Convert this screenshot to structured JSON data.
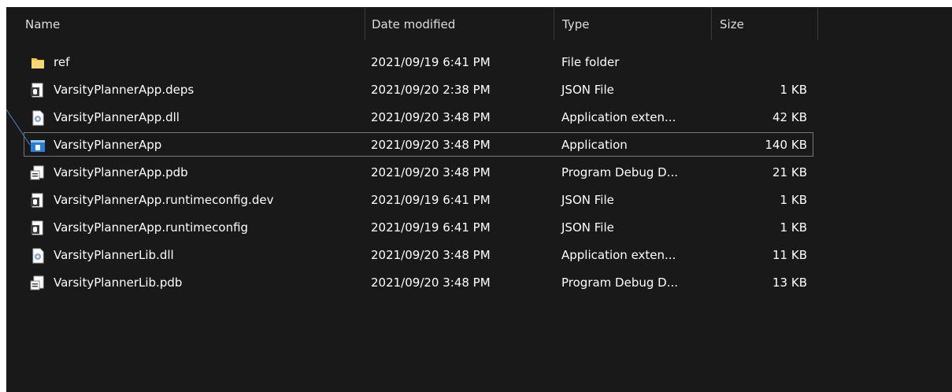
{
  "columns": {
    "name": "Name",
    "date_modified": "Date modified",
    "type": "Type",
    "size": "Size"
  },
  "files": [
    {
      "name": "ref",
      "date": "2021/09/19 6:41 PM",
      "type": "File folder",
      "size": "",
      "icon": "folder-icon"
    },
    {
      "name": "VarsityPlannerApp.deps",
      "date": "2021/09/20 2:38 PM",
      "type": "JSON File",
      "size": "1 KB",
      "icon": "json-file-icon"
    },
    {
      "name": "VarsityPlannerApp.dll",
      "date": "2021/09/20 3:48 PM",
      "type": "Application exten...",
      "size": "42 KB",
      "icon": "dll-file-icon"
    },
    {
      "name": "VarsityPlannerApp",
      "date": "2021/09/20 3:48 PM",
      "type": "Application",
      "size": "140 KB",
      "icon": "application-icon",
      "selected": true
    },
    {
      "name": "VarsityPlannerApp.pdb",
      "date": "2021/09/20 3:48 PM",
      "type": "Program Debug D...",
      "size": "21 KB",
      "icon": "pdb-file-icon"
    },
    {
      "name": "VarsityPlannerApp.runtimeconfig.dev",
      "date": "2021/09/19 6:41 PM",
      "type": "JSON File",
      "size": "1 KB",
      "icon": "json-file-icon"
    },
    {
      "name": "VarsityPlannerApp.runtimeconfig",
      "date": "2021/09/19 6:41 PM",
      "type": "JSON File",
      "size": "1 KB",
      "icon": "json-file-icon"
    },
    {
      "name": "VarsityPlannerLib.dll",
      "date": "2021/09/20 3:48 PM",
      "type": "Application exten...",
      "size": "11 KB",
      "icon": "dll-file-icon"
    },
    {
      "name": "VarsityPlannerLib.pdb",
      "date": "2021/09/20 3:48 PM",
      "type": "Program Debug D...",
      "size": "13 KB",
      "icon": "pdb-file-icon"
    }
  ],
  "colors": {
    "background": "#191919",
    "text": "#ffffff",
    "header_text": "#dedede",
    "selection_border": "#777777",
    "folder": "#f2c84b",
    "app_icon": "#2a7fd4",
    "pointer_line": "#4a6fa5"
  }
}
